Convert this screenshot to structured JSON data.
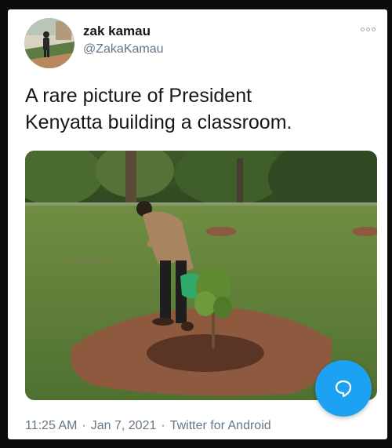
{
  "tweet": {
    "author": {
      "display_name": "zak kamau",
      "handle": "@ZakaKamau",
      "avatar_icon": "person-photo-icon"
    },
    "text_lines": [
      "A rare picture of President",
      "Kenyatta building a classroom."
    ],
    "media": {
      "kind": "photo",
      "icon": "man-watering-tree-photo"
    },
    "meta": {
      "time": "11:25 AM",
      "separator": "·",
      "date": "Jan 7, 2021",
      "source": "Twitter for Android"
    },
    "more_icon": "more-options-icon"
  },
  "compose_button": {
    "icon": "compose-bubble-icon",
    "color": "#1da1f2"
  },
  "colors": {
    "background": "#0b0b0b",
    "card": "#ffffff",
    "text": "#14171a",
    "muted": "#657786",
    "accent": "#1da1f2"
  }
}
